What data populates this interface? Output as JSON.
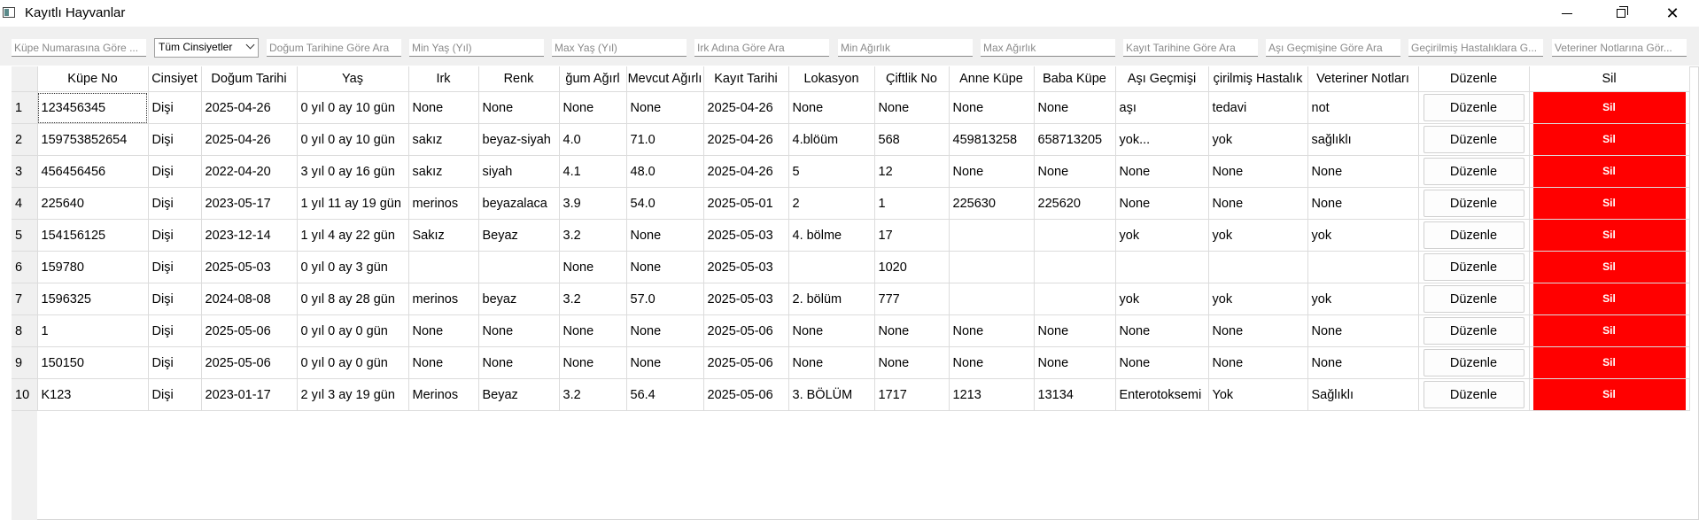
{
  "window": {
    "title": "Kayıtlı Hayvanlar",
    "minimize_icon": "minimize-icon",
    "maximize_icon": "restore-icon",
    "close_glyph": "✕"
  },
  "filters": {
    "kupe_placeholder": "Küpe Numarasına Göre ...",
    "cinsiyet_selected": "Tüm Cinsiyetler",
    "dogum_placeholder": "Doğum Tarihine Göre Ara",
    "min_yas_placeholder": "Min Yaş (Yıl)",
    "max_yas_placeholder": "Max Yaş (Yıl)",
    "irk_placeholder": "Irk Adına Göre Ara",
    "min_agirlik_placeholder": "Min Ağırlık",
    "max_agirlik_placeholder": "Max Ağırlık",
    "kayit_placeholder": "Kayıt Tarihine Göre Ara",
    "asi_placeholder": "Aşı Geçmişine Göre Ara",
    "hastalik_placeholder": "Geçirilmiş Hastalıklara G...",
    "veteriner_placeholder": "Veteriner Notlarına Gör..."
  },
  "table": {
    "headers": [
      "Küpe No",
      "Cinsiyet",
      "Doğum Tarihi",
      "Yaş",
      "Irk",
      "Renk",
      "ğum Ağırl",
      "Mevcut Ağırlı",
      "Kayıt Tarihi",
      "Lokasyon",
      "Çiftlik No",
      "Anne Küpe",
      "Baba Küpe",
      "Aşı Geçmişi",
      "çirilmiş Hastalık",
      "Veteriner Notları",
      "Düzenle",
      "Sil"
    ],
    "edit_label": "Düzenle",
    "delete_label": "Sil",
    "rows": [
      {
        "num": "1",
        "cells": [
          "123456345",
          "Dişi",
          "2025-04-26",
          "0 yıl 0 ay 10 gün",
          "None",
          "None",
          "None",
          "None",
          "2025-04-26",
          "None",
          "None",
          "None",
          "None",
          "aşı",
          "tedavi",
          "not"
        ]
      },
      {
        "num": "2",
        "cells": [
          "159753852654",
          "Dişi",
          "2025-04-26",
          "0 yıl 0 ay 10 gün",
          "sakız",
          "beyaz-siyah",
          "4.0",
          "71.0",
          "2025-04-26",
          "4.blöüm",
          "568",
          "459813258",
          "658713205",
          "yok...",
          "yok",
          "sağlıklı"
        ]
      },
      {
        "num": "3",
        "cells": [
          "456456456",
          "Dişi",
          "2022-04-20",
          "3 yıl 0 ay 16 gün",
          "sakız",
          "siyah",
          "4.1",
          "48.0",
          "2025-04-26",
          "5",
          "12",
          "None",
          "None",
          "None",
          "None",
          "None"
        ]
      },
      {
        "num": "4",
        "cells": [
          "225640",
          "Dişi",
          "2023-05-17",
          "1 yıl 11 ay 19 gün",
          "merinos",
          "beyazalaca",
          "3.9",
          "54.0",
          "2025-05-01",
          "2",
          "1",
          "225630",
          "225620",
          "None",
          "None",
          "None"
        ]
      },
      {
        "num": "5",
        "cells": [
          "154156125",
          "Dişi",
          "2023-12-14",
          "1 yıl 4 ay 22 gün",
          "Sakız",
          "Beyaz",
          "3.2",
          "None",
          "2025-05-03",
          "4. bölme",
          "17",
          "",
          "",
          "yok",
          "yok",
          "yok"
        ]
      },
      {
        "num": "6",
        "cells": [
          "159780",
          "Dişi",
          "2025-05-03",
          "0 yıl 0 ay 3 gün",
          "",
          "",
          "None",
          "None",
          "2025-05-03",
          "",
          "1020",
          "",
          "",
          "",
          "",
          ""
        ]
      },
      {
        "num": "7",
        "cells": [
          "1596325",
          "Dişi",
          "2024-08-08",
          "0 yıl 8 ay 28 gün",
          "merinos",
          "beyaz",
          "3.2",
          "57.0",
          "2025-05-03",
          "2. bölüm",
          "777",
          "",
          "",
          "yok",
          "yok",
          "yok"
        ]
      },
      {
        "num": "8",
        "cells": [
          "1",
          "Dişi",
          "2025-05-06",
          "0 yıl 0 ay 0 gün",
          "None",
          "None",
          "None",
          "None",
          "2025-05-06",
          "None",
          "None",
          "None",
          "None",
          "None",
          "None",
          "None"
        ]
      },
      {
        "num": "9",
        "cells": [
          "150150",
          "Dişi",
          "2025-05-06",
          "0 yıl 0 ay 0 gün",
          "None",
          "None",
          "None",
          "None",
          "2025-05-06",
          "None",
          "None",
          "None",
          "None",
          "None",
          "None",
          "None"
        ]
      },
      {
        "num": "10",
        "cells": [
          "K123",
          "Dişi",
          "2023-01-17",
          "2 yıl 3 ay 19 gün",
          "Merinos",
          "Beyaz",
          "3.2",
          "56.4",
          "2025-05-06",
          "3. BÖLÜM",
          "1717",
          "1213",
          "13134",
          "Enterotoksemi",
          "Yok",
          "Sağlıklı"
        ]
      }
    ]
  },
  "colors": {
    "delete_button": "#ff0000",
    "row_header_bg": "#f0f0f0",
    "filter_bar_bg": "#f0f0f0"
  }
}
